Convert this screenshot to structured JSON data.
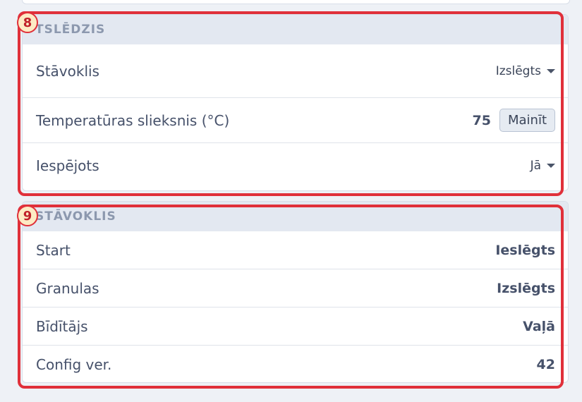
{
  "switch_section": {
    "badge": "8",
    "header": "TSLĒDZIS",
    "rows": [
      {
        "label": "Stāvoklis",
        "value": "Izslēgts"
      },
      {
        "label": "Temperatūras slieksnis (°C)",
        "value": "75",
        "button_label": "Mainīt"
      },
      {
        "label": "Iespējots",
        "value": "Jā"
      }
    ]
  },
  "status_section": {
    "badge": "9",
    "header": "STĀVOKLIS",
    "rows": [
      {
        "label": "Start",
        "value": "Ieslēgts"
      },
      {
        "label": "Granulas",
        "value": "Izslēgts"
      },
      {
        "label": "Bīdītājs",
        "value": "Vaļā"
      },
      {
        "label": "Config ver.",
        "value": "42"
      }
    ]
  },
  "colors": {
    "highlight": "#e0303a",
    "badge_fill": "#fdebc4",
    "header_bg": "#e3e8f1",
    "page_bg": "#eef1f6"
  },
  "icons": {
    "dropdown": "caret-down-icon"
  }
}
